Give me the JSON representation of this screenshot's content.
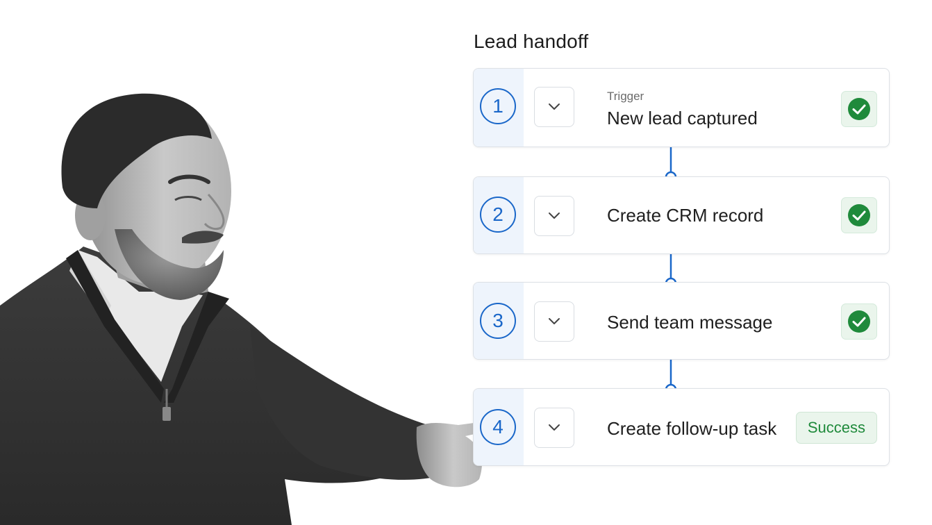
{
  "workflow": {
    "title": "Lead handoff",
    "steps": [
      {
        "number": "1",
        "sublabel": "Trigger",
        "label": "New lead captured",
        "status": "check"
      },
      {
        "number": "2",
        "label": "Create CRM record",
        "status": "check"
      },
      {
        "number": "3",
        "label": "Send team message",
        "status": "check"
      },
      {
        "number": "4",
        "label": "Create follow-up task",
        "status": "badge",
        "badge": "Success"
      }
    ]
  },
  "colors": {
    "accent_blue": "#1a67c9",
    "number_column_bg": "#eef4fc",
    "success_green": "#1f8a3b",
    "success_bg": "#eaf5ec"
  },
  "icons": {
    "expand": "chevron-down-icon",
    "done": "check-circle-icon"
  }
}
